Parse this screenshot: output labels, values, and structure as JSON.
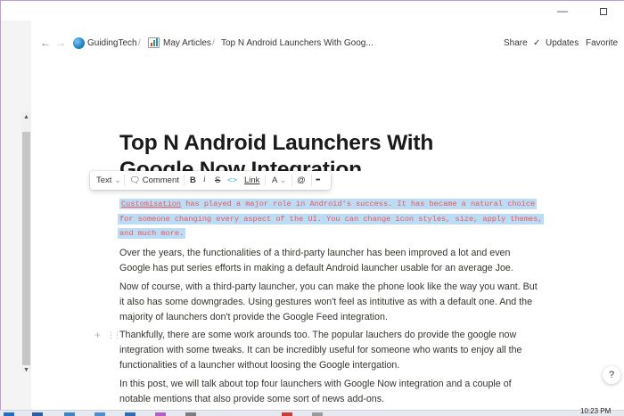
{
  "window": {
    "minimize_glyph": "—",
    "maximize_glyph": ""
  },
  "nav": {
    "back_icon": "arrow-left-icon",
    "forward_icon": "arrow-right-icon",
    "breadcrumbs": [
      {
        "label": "GuidingTech",
        "icon": "globe-icon"
      },
      {
        "label": "May Articles",
        "icon": "bar-chart-icon"
      },
      {
        "label": "Top N Android Launchers With Goog..."
      }
    ],
    "separator": "/",
    "actions": {
      "share": "Share",
      "updates": "Updates",
      "favorite": "Favorite"
    }
  },
  "page": {
    "title_line1": "Top N Android Launchers With",
    "title_line2": "Google Now Integration"
  },
  "toolbar": {
    "text_label": "Text",
    "comment_label": "Comment",
    "bold": "B",
    "italic": "i",
    "strike": "S",
    "code": "<>",
    "link": "Link",
    "color": "A",
    "mention": "@",
    "more": "•••",
    "chevron": "⌄"
  },
  "code_block": {
    "word1": "Customisation",
    "line1_rest": " has played a major role in Android's success. It has became a natural choice",
    "line2": "for someone changing every aspect of the UI. You can change icon styles, size, apply themes,",
    "line3": "and much more."
  },
  "paragraphs": [
    {
      "lines": [
        "Over the years, the functionalities of a third-party launcher has been improved a lot and even",
        "Google has put series efforts in making a default Android launcher usable for an average Joe."
      ]
    },
    {
      "lines": [
        "Now of course, with a third-party launcher, you can make the phone look like the way you want. But",
        "it also has some downgrades. Using gestures won't feel as intitutive as with a default one. And the",
        "majority of launchers don't provide the Google Feed integration."
      ]
    },
    {
      "lines": [
        "Thankfully, there are some work arounds too. The popular lauchers do provide the google now",
        "integration with some tweaks. It can be incredibly useful for someone who wants to enjoy all the",
        "functionalities of a launcher without loosing the Google intergation."
      ]
    },
    {
      "lines": [
        "In this post, we will talk about top four launchers with Google Now integration and a couple of",
        "notable mentions that also provide some sort of news add-ons."
      ]
    }
  ],
  "block_controls": {
    "add": "+",
    "drag": "⋮⋮"
  },
  "help": {
    "label": "?"
  },
  "taskbar": {
    "time": "10:23 PM"
  },
  "colors": {
    "highlight": "#bcdcf5",
    "code_text": "#eb5757",
    "body_text": "#37352f"
  }
}
